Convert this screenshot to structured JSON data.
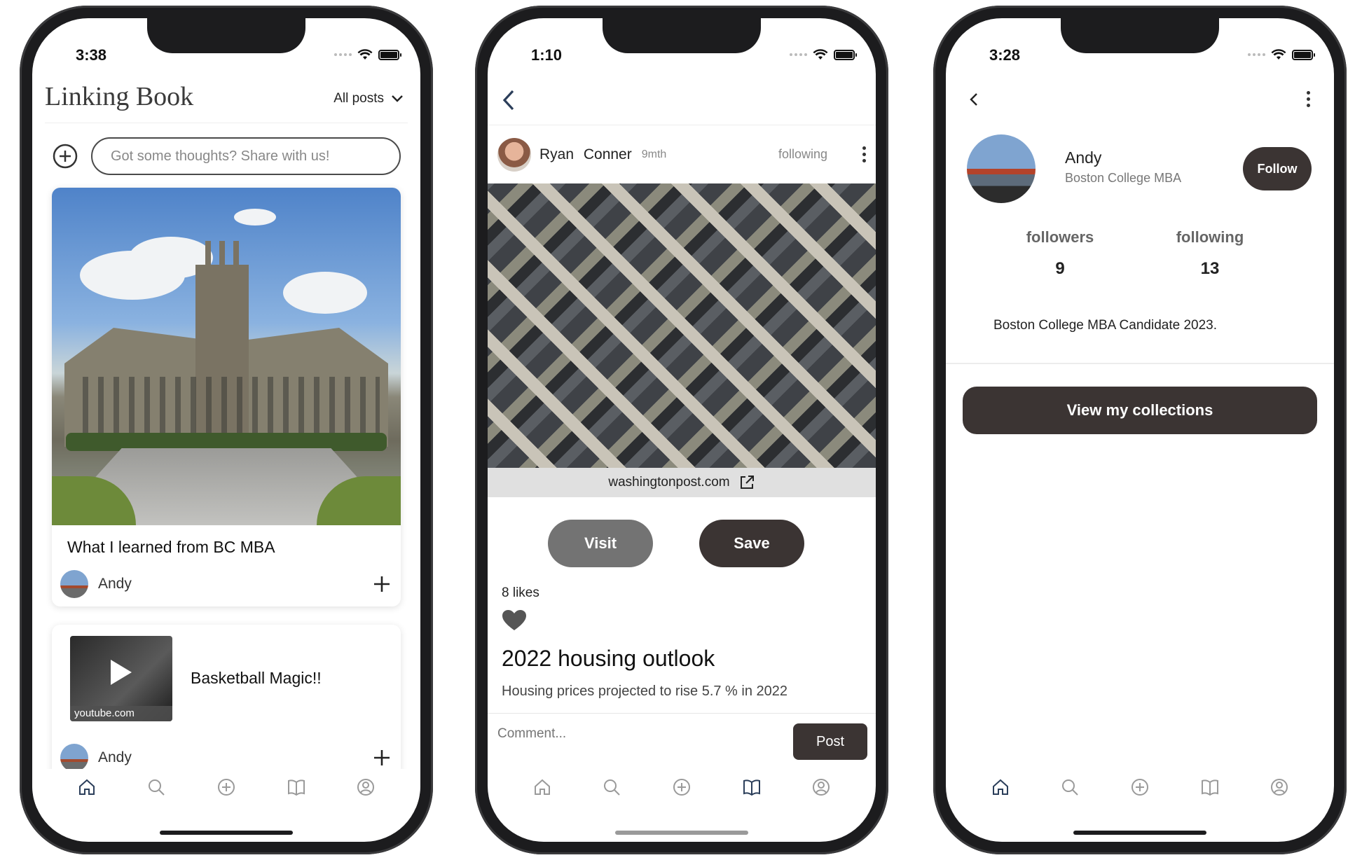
{
  "colors": {
    "dark_button": "#3b3433",
    "visit_button": "#737373",
    "tab_active": "#2b3e5a",
    "tab_inactive": "#9a9a9a"
  },
  "phone1": {
    "status_time": "3:38",
    "app_title": "Linking Book",
    "filter_label": "All posts",
    "composer_placeholder": "Got some thoughts? Share with us!",
    "posts": [
      {
        "title": "What I learned from BC MBA",
        "author": "Andy"
      },
      {
        "title": "Basketball Magic!!",
        "source": "youtube.com",
        "author": "Andy"
      }
    ],
    "active_tab": "home-icon"
  },
  "phone2": {
    "status_time": "1:10",
    "post": {
      "author": "Ryan Conner",
      "age": "9mth",
      "follow_status": "following",
      "link_domain": "washingtonpost.com",
      "visit_label": "Visit",
      "save_label": "Save",
      "likes": "8 likes",
      "title": "2022 housing outlook",
      "description": "Housing prices projected to rise 5.7 % in 2022"
    },
    "comment_placeholder": "Comment...",
    "post_button": "Post",
    "active_tab": "book-icon"
  },
  "phone3": {
    "status_time": "3:28",
    "profile": {
      "name": "Andy",
      "subtitle": "Boston College MBA",
      "follow_label": "Follow",
      "followers_label": "followers",
      "followers_count": "9",
      "following_label": "following",
      "following_count": "13",
      "bio": "Boston College MBA Candidate 2023.",
      "collections_label": "View my collections"
    },
    "active_tab": "home-icon"
  },
  "tabbar_icons": [
    "home-icon",
    "search-icon",
    "add-circle-icon",
    "book-icon",
    "profile-icon"
  ]
}
